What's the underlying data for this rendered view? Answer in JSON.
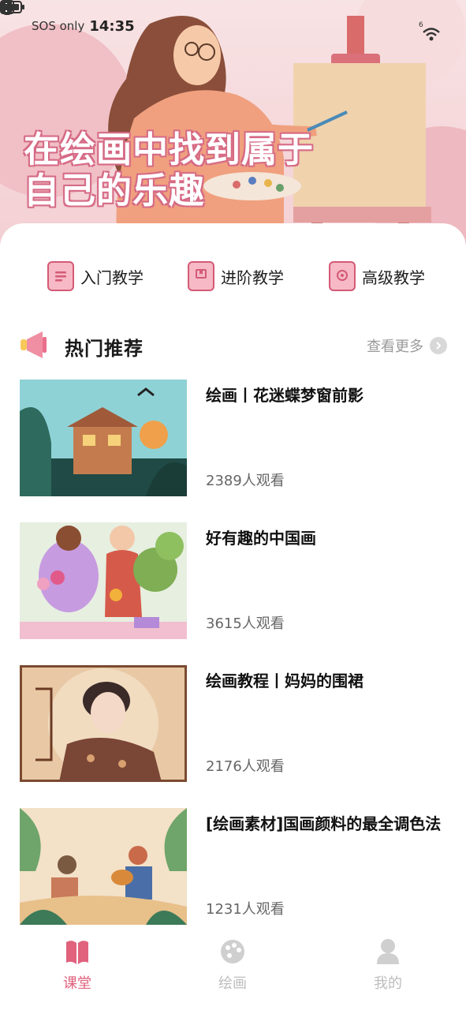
{
  "status_bar": {
    "carrier": "SOS only",
    "time": "14:35",
    "network_label": "6"
  },
  "banner": {
    "slogan_line1": "在绘画中找到属于",
    "slogan_line2": "自己的乐趣"
  },
  "categories": [
    {
      "label": "入门教学",
      "icon": "list-doc-icon"
    },
    {
      "label": "进阶教学",
      "icon": "book-icon"
    },
    {
      "label": "高级教学",
      "icon": "flower-bookmark-icon"
    }
  ],
  "section": {
    "title": "热门推荐",
    "more_label": "查看更多"
  },
  "courses": [
    {
      "title": "绘画丨花迷蝶梦窗前影",
      "views": "2389人观看"
    },
    {
      "title": "好有趣的中国画",
      "views": "3615人观看"
    },
    {
      "title": "绘画教程丨妈妈的围裙",
      "views": "2176人观看"
    },
    {
      "title": "[绘画素材]国画颜料的最全调色法",
      "views": "1231人观看"
    }
  ],
  "tabs": [
    {
      "label": "课堂",
      "active": true
    },
    {
      "label": "绘画",
      "active": false
    },
    {
      "label": "我的",
      "active": false
    }
  ],
  "colors": {
    "accent": "#e0627d",
    "hero_bg": "#f3cfd3",
    "tab_inactive": "#bdbdbd",
    "muted_text": "#9a9a9a"
  }
}
